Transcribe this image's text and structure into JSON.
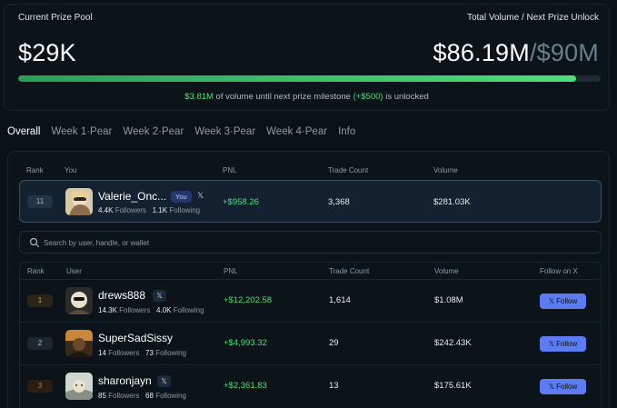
{
  "prize": {
    "pool_label": "Current Prize Pool",
    "volume_label": "Total Volume / Next Prize Unlock",
    "pool_value": "$29K",
    "volume_current": "$86.19M",
    "volume_separator": "/",
    "volume_target": "$90M",
    "progress_fraction": 0.958,
    "note_amount": "$3.81M",
    "note_text_1": " of volume until next prize milestone ",
    "note_bonus": "(+$500)",
    "note_text_2": " is unlocked"
  },
  "tabs": [
    "Overall",
    "Week 1·Pear",
    "Week 2·Pear",
    "Week 3·Pear",
    "Week 4·Pear",
    "Info"
  ],
  "active_tab": 0,
  "you_headers": {
    "rank": "Rank",
    "you": "You",
    "pnl": "PNL",
    "trades": "Trade Count",
    "volume": "Volume"
  },
  "you": {
    "rank": "11",
    "name": "Valerie_Onc...",
    "badge": "You",
    "x_icon": "𝕏",
    "followers": "4.4K",
    "followers_label": "Followers",
    "following": "1.1K",
    "following_label": "Following",
    "pnl": "+$958.26",
    "trades": "3,368",
    "volume": "$281.03K"
  },
  "search": {
    "placeholder": "Search by user, handle, or wallet"
  },
  "table_headers": {
    "rank": "Rank",
    "user": "User",
    "pnl": "PNL",
    "trades": "Trade Count",
    "volume": "Volume",
    "follow": "Follow on X"
  },
  "rows": [
    {
      "rank": "1",
      "name": "drews888",
      "followers": "14.3K",
      "following": "4.0K",
      "pnl": "+$12,202.58",
      "trades": "1,614",
      "volume": "$1.08M",
      "follow_label": "Follow"
    },
    {
      "rank": "2",
      "name": "SuperSadSissy",
      "followers": "14",
      "following": "73",
      "pnl": "+$4,993.32",
      "trades": "29",
      "volume": "$242.43K",
      "follow_label": "Follow"
    },
    {
      "rank": "3",
      "name": "sharonjayn",
      "followers": "85",
      "following": "68",
      "pnl": "+$2,361.83",
      "trades": "13",
      "volume": "$175.61K",
      "follow_label": "Follow"
    }
  ],
  "labels": {
    "followers": "Followers",
    "following": "Following",
    "x_icon": "𝕏"
  },
  "colors": {
    "accent_green": "#4be07a",
    "follow_button": "#5b7cf2",
    "rank1": "#c9a24a",
    "rank3": "#c77a3c"
  }
}
